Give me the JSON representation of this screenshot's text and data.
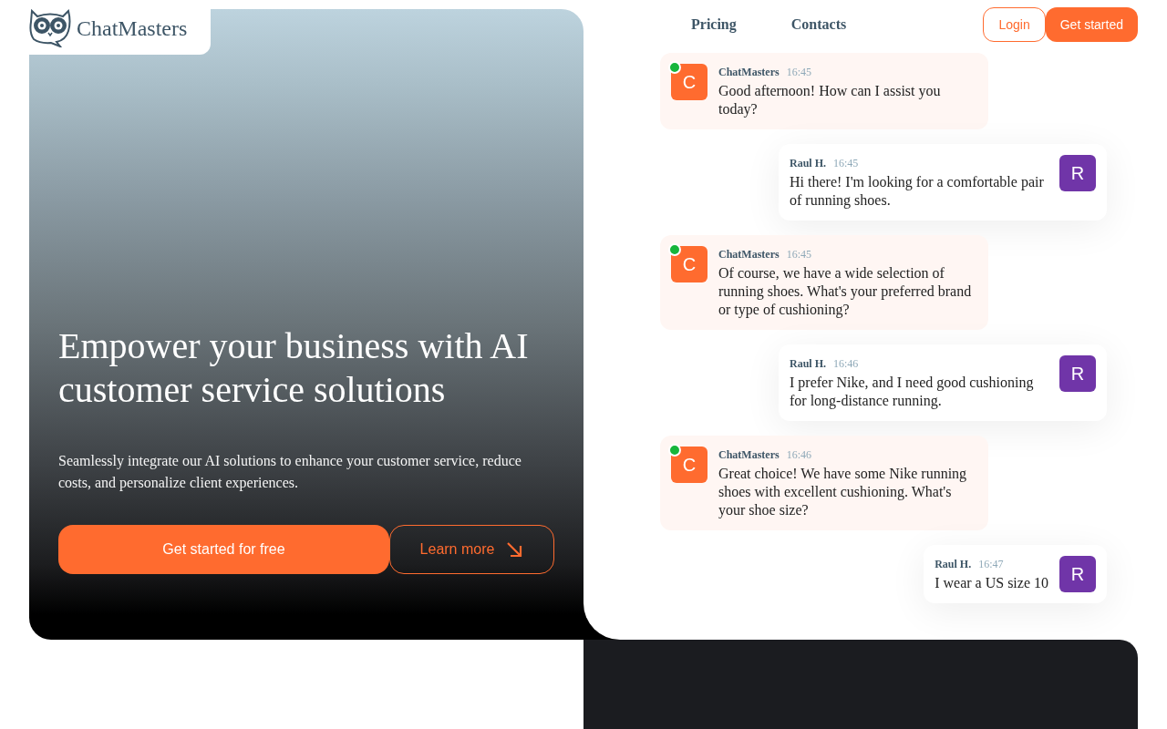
{
  "brand": "ChatMasters",
  "nav": [
    "Pricing",
    "Contacts"
  ],
  "header_buttons": [
    {
      "label": "Login",
      "kind": "outline"
    },
    {
      "label": "Get started",
      "kind": "solid"
    }
  ],
  "hero": {
    "title": "Empower your business with AI customer service solutions",
    "text": "Seamlessly integrate our AI solutions to enhance your customer service, reduce costs, and personalize client experiences.",
    "primary_button": "Get started for free",
    "secondary_button": "Learn more"
  },
  "messages": [
    {
      "kind": "bot",
      "avatar": "C",
      "online": true,
      "author": "ChatMasters",
      "time": "16:45",
      "text": "Good afternoon! How can I assist you today?"
    },
    {
      "kind": "user",
      "avatar": "R",
      "author": "Raul H.",
      "time": "16:45",
      "text": "Hi there! I'm looking for a comfortable pair of running shoes."
    },
    {
      "kind": "bot",
      "avatar": "C",
      "online": true,
      "author": "ChatMasters",
      "time": "16:45",
      "text": "Of course, we have a wide selection of running shoes. What's your preferred brand or type of cushioning?"
    },
    {
      "kind": "user",
      "avatar": "R",
      "author": "Raul H.",
      "time": "16:46",
      "text": "I prefer Nike, and I need good cushioning for long-distance running."
    },
    {
      "kind": "bot",
      "avatar": "C",
      "online": true,
      "author": "ChatMasters",
      "time": "16:46",
      "text": "Great choice! We have some Nike running shoes with excellent cushioning. What's your shoe size?"
    },
    {
      "kind": "user",
      "avatar": "R",
      "author": "Raul H.",
      "time": "16:47",
      "text": "I wear a US size 10"
    }
  ]
}
